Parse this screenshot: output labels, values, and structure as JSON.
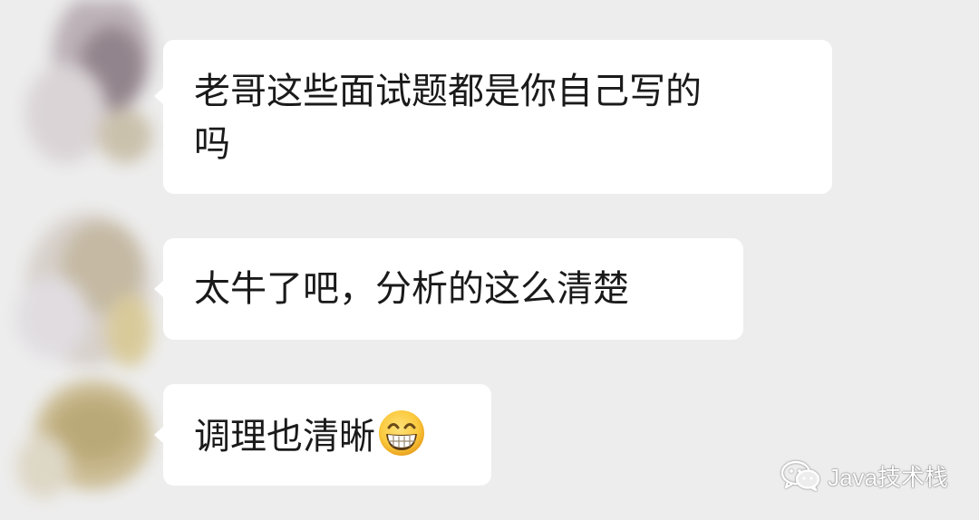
{
  "messages": [
    {
      "text_line1": "老哥这些面试题都是你自己写的",
      "text_line2": "吗"
    },
    {
      "text": "太牛了吧，分析的这么清楚"
    },
    {
      "text": "调理也清晰",
      "emoji": "grinning-face-emoji"
    }
  ],
  "watermark": {
    "text": "Java技术栈",
    "icon": "wechat-icon"
  },
  "colors": {
    "background": "#ededed",
    "bubble": "#ffffff",
    "text": "#1a1a1a"
  }
}
